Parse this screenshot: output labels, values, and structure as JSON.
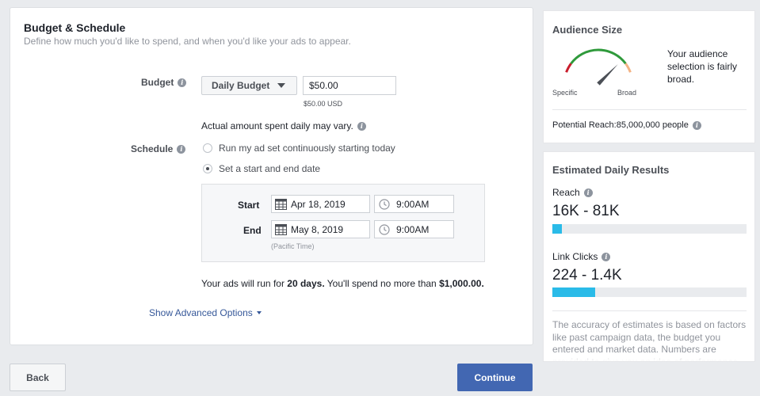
{
  "budget_schedule": {
    "title": "Budget & Schedule",
    "subtitle": "Define how much you'd like to spend, and when you'd like your ads to appear.",
    "budget": {
      "label": "Budget",
      "type_selected": "Daily Budget",
      "amount": "$50.00",
      "amount_note": "$50.00 USD",
      "variance_note": "Actual amount spent daily may vary."
    },
    "schedule": {
      "label": "Schedule",
      "options": [
        {
          "label": "Run my ad set continuously starting today",
          "selected": false
        },
        {
          "label": "Set a start and end date",
          "selected": true
        }
      ],
      "start_label": "Start",
      "start_date": "Apr 18, 2019",
      "start_time": "9:00AM",
      "end_label": "End",
      "end_date": "May 8, 2019",
      "end_time": "9:00AM",
      "timezone_note": "(Pacific Time)"
    },
    "summary": {
      "prefix": "Your ads will run for ",
      "days": "20 days.",
      "middle": " You'll spend no more than ",
      "total": "$1,000.00."
    },
    "advanced_link": "Show Advanced Options"
  },
  "footer": {
    "back_label": "Back",
    "continue_label": "Continue"
  },
  "audience_size": {
    "title": "Audience Size",
    "label_specific": "Specific",
    "label_broad": "Broad",
    "description": "Your audience selection is fairly broad.",
    "reach_label": "Potential Reach:",
    "reach_value": "85,000,000 people",
    "gauge_position": 0.82,
    "colors": {
      "red": "#c91d2c",
      "green": "#2f9a3b",
      "orange": "#f3b384",
      "needle": "#4b4f56"
    }
  },
  "estimated_daily_results": {
    "title": "Estimated Daily Results",
    "metrics": [
      {
        "label": "Reach",
        "value": "16K - 81K",
        "fill": 0.05
      },
      {
        "label": "Link Clicks",
        "value": "224 - 1.4K",
        "fill": 0.22
      }
    ],
    "disclaimer": "The accuracy of estimates is based on factors like past campaign data, the budget you entered and market data. Numbers are provided to give you an idea of performance for your budget, but are only estimates and don't guarantee results.",
    "bar_color": "#2abbe8"
  }
}
